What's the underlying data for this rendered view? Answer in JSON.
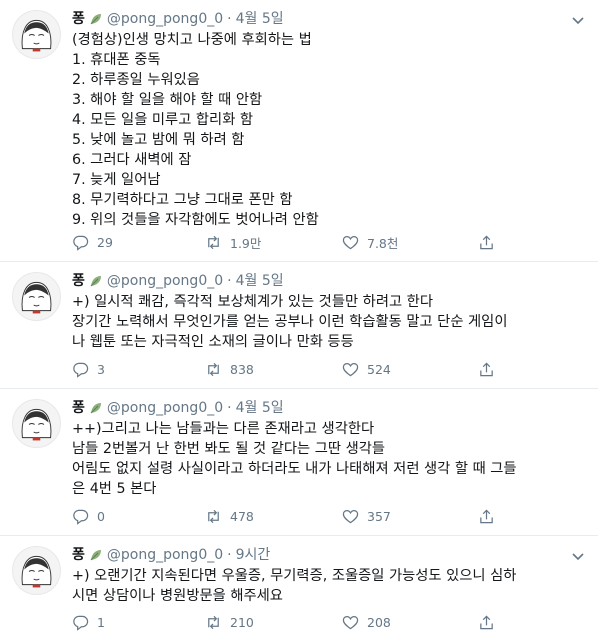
{
  "tweets": [
    {
      "name": "퐁",
      "handle": "@pong_pong0_0",
      "dot": "·",
      "time": "4월 5일",
      "lines": [
        "(경험상)인생 망치고 나중에 후회하는 법",
        "1. 휴대폰 중독",
        "2. 하루종일 누워있음",
        "3. 해야 할 일을 해야 할 때 안함",
        "4. 모든 일을 미루고 합리화 함",
        "5. 낮에 놀고 밤에 뭐 하려 함",
        "6. 그러다 새벽에 잠",
        "7. 늦게 일어남",
        "8. 무기력하다고 그냥 그대로 폰만 함",
        "9. 위의 것들을 자각함에도 벗어나려 안함"
      ],
      "replies": "29",
      "retweets": "1.9만",
      "likes": "7.8천"
    },
    {
      "name": "퐁",
      "handle": "@pong_pong0_0",
      "dot": "·",
      "time": "4월 5일",
      "lines": [
        "+) 일시적 쾌감, 즉각적 보상체계가 있는 것들만 하려고 한다",
        "장기간 노력해서 무엇인가를 얻는 공부나 이런 학습활동 말고 단순 게임이",
        "나 웹툰 또는 자극적인 소재의 글이나 만화 등등"
      ],
      "replies": "3",
      "retweets": "838",
      "likes": "524"
    },
    {
      "name": "퐁",
      "handle": "@pong_pong0_0",
      "dot": "·",
      "time": "4월 5일",
      "lines": [
        "++)그리고 나는 남들과는 다른 존재라고 생각한다",
        "남들 2번볼거 난 한번 봐도 될 것 같다는 그딴 생각들",
        "어림도 없지 설령 사실이라고 하더라도 내가 나태해져 저런 생각 할 때 그들",
        "은 4번 5 본다"
      ],
      "replies": "0",
      "retweets": "478",
      "likes": "357"
    },
    {
      "name": "퐁",
      "handle": "@pong_pong0_0",
      "dot": "·",
      "time": "9시간",
      "lines": [
        "+) 오랜기간 지속된다면 우울증, 무기력증, 조울증일 가능성도 있으니 심하",
        "시면 상담이나 병원방문을 해주세요"
      ],
      "replies": "1",
      "retweets": "210",
      "likes": "208"
    }
  ],
  "icons": {
    "reply": "reply-icon",
    "retweet": "retweet-icon",
    "like": "heart-icon",
    "share": "share-icon",
    "more": "chevron-down-icon",
    "badge": "leaf-emoji-icon"
  },
  "colors": {
    "text": "#14171a",
    "secondary": "#657786",
    "divider": "#e6ecf0"
  }
}
